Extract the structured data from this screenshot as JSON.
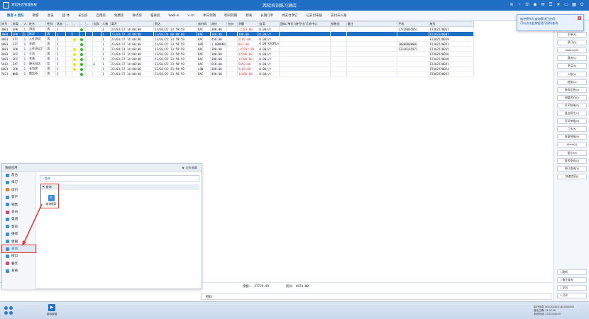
{
  "titlebar": {
    "app_name": "宾馆住店管理系统",
    "window_title": "西软培训练习酒店",
    "icons": [
      "wifi-icon",
      "bell-icon",
      "phone-icon",
      "chat-icon",
      "message-icon",
      "list-icon",
      "star-icon",
      "monitor-icon",
      "grid-icon",
      "power-icon"
    ]
  },
  "tabs": [
    "散客 & 团队",
    "散客",
    "会员",
    "团 体",
    "长包房",
    "自用房",
    "免费房",
    "钟点房",
    "临离房",
    "Walk-in",
    "V I P",
    "本日到期",
    "明日到期",
    "预离",
    "长期订单",
    "待支付预订",
    "已支付未抵",
    "支付未入账"
  ],
  "table": {
    "headers": [
      "房号",
      "房类",
      "人",
      "姓名",
      "性别",
      "状态",
      "-",
      "-",
      "-",
      "-",
      "欠款",
      "人数",
      "离开",
      "到达",
      "房价码",
      "房价",
      "包价",
      "余额",
      "信用",
      "团体/单位/旅行社/订房中心",
      "销售员",
      "备注",
      "手机",
      "账号"
    ],
    "rows": [
      {
        "room": "3001",
        "type": "SPK",
        "n": "1",
        "name": "测试",
        "sex": "男",
        "st": "I",
        "d1": "",
        "d2": "",
        "d3": "green",
        "d4": "",
        "owe": "",
        "num": "1",
        "dep": "23/03/17 14:00:00",
        "arr": "23/03/22 23:59:59",
        "code": "RAC",
        "rate": "388.00",
        "pkg": "",
        "bal": "-2183.00",
        "bal_neg": true,
        "credit": "0.00///",
        "group": "",
        "sales": "",
        "memo": "",
        "phone": "17328065051",
        "acct": "F2302220017",
        "sel": false
      },
      {
        "room": "3004",
        "type": "SPK",
        "n": "1",
        "name": "陈洋",
        "sex": "男",
        "st": "I",
        "d1": "",
        "d2": "",
        "d3": "",
        "d4": "",
        "owe": "",
        "num": "1",
        "dep": "23/03/17 14:00:00",
        "arr": "23/03/24 00:00:00",
        "code": "RAC",
        "rate": "388.00",
        "pkg": "",
        "bal": "388.00",
        "bal_neg": false,
        "credit": "0.00///",
        "group": "",
        "sales": "",
        "memo": "",
        "phone": "",
        "acct": "F2303140001",
        "sel": true
      },
      {
        "room": "4001",
        "type": "STT",
        "n": "1",
        "name": "入住测试",
        "sex": "男",
        "st": "I",
        "d1": "",
        "d2": "yellow",
        "d3": "green",
        "d4": "",
        "owe": "",
        "num": "1",
        "dep": "23/03/17 14:00:00",
        "arr": "23/03/22 23:59:59",
        "code": "RAC",
        "rate": "458.00",
        "pkg": "",
        "bal": "5185.00",
        "bal_neg": true,
        "credit": "0.00///",
        "group": "",
        "sales": "",
        "memo": "",
        "phone": "",
        "acct": "F2302220019",
        "sel": false
      },
      {
        "room": "4003",
        "type": "STT",
        "n": "1",
        "name": "李斌",
        "sex": "男",
        "st": "I",
        "d1": "",
        "d2": "",
        "d3": "green",
        "d4": "",
        "owe": "",
        "num": "1",
        "dep": "23/03/17 14:00:00",
        "arr": "23/03/22 23:59:59",
        "code": "GRP",
        "rate": "1.00DKK0",
        "pkg": "",
        "bal": "861.00",
        "bal_neg": true,
        "credit": "0.00飞利团队///",
        "group": "",
        "sales": "",
        "memo": "",
        "phone": "18800000003",
        "acct": "F2302220023",
        "sel": false
      },
      {
        "room": "3081",
        "type": "SPK",
        "n": "1",
        "name": "入住测试2",
        "sex": "男",
        "st": "I",
        "d1": "",
        "d2": "yellow",
        "d3": "green",
        "d4": "",
        "owe": "",
        "num": "1",
        "dep": "23/04/11 14:00:00",
        "arr": "23/03/22 23:59:59",
        "code": "RAC",
        "rate": "388.00",
        "pkg": "",
        "bal": "-87592.00",
        "bal_neg": true,
        "credit": "0.00///",
        "group": "",
        "sales": "",
        "memo": "",
        "phone": "13336165971",
        "acct": "F2302220015",
        "sel": false
      },
      {
        "room": "3083",
        "type": "SPI",
        "n": "1",
        "name": "王尚",
        "sex": "男",
        "st": "I",
        "d1": "",
        "d2": "yellow",
        "d3": "green",
        "d4": "",
        "owe": "",
        "num": "1",
        "dep": "23/03/17 14:00:00",
        "arr": "23/03/22 23:59:59",
        "code": "RAC",
        "rate": "388.00",
        "pkg": "",
        "bal": "12188.00",
        "bal_neg": true,
        "credit": "0.00///",
        "group": "",
        "sales": "",
        "memo": "",
        "phone": "",
        "acct": "F2302220016",
        "sel": false
      },
      {
        "room": "5083",
        "type": "SPI",
        "n": "1",
        "name": "李逸",
        "sex": "男",
        "st": "I",
        "d1": "",
        "d2": "yellow",
        "d3": "green",
        "d4": "",
        "owe": "",
        "num": "1",
        "dep": "23/03/17 14:00:00",
        "arr": "23/03/22 23:59:59",
        "code": "RAC",
        "rate": "388.00",
        "pkg": "",
        "bal": "12188.00",
        "bal_neg": true,
        "credit": "0.00///",
        "group": "",
        "sales": "",
        "memo": "",
        "phone": "",
        "acct": "F2302220020",
        "sel": false
      },
      {
        "room": "5012",
        "type": "EXT",
        "n": "1",
        "name": "康光回店",
        "sex": "女",
        "st": "I",
        "d1": "",
        "d2": "yellow",
        "d3": "green",
        "d4": "",
        "owe": "6",
        "num": "1",
        "dep": "23/03/17 14:00:00",
        "arr": "23/03/22 23:59:59",
        "code": "RAC",
        "rate": "658.00",
        "pkg": "",
        "bal": "5658.00",
        "bal_neg": true,
        "credit": "0.00///",
        "group": "",
        "sales": "",
        "memo": "",
        "phone": "",
        "acct": "F2302220021",
        "sel": false
      },
      {
        "room": "6001",
        "type": "SPK",
        "n": "1",
        "name": "长包房",
        "sex": "男",
        "st": "I",
        "d1": "",
        "d2": "yellow",
        "d3": "green",
        "d4": "",
        "owe": "",
        "num": "1",
        "dep": "23/03/17 14:00:00",
        "arr": "23/03/22 23:59:59",
        "code": "LON",
        "rate": "388.00",
        "pkg": "",
        "bal": "5169.00",
        "bal_neg": true,
        "credit": "0.00///",
        "group": "",
        "sales": "",
        "memo": "",
        "phone": "",
        "acct": "F2302220024",
        "sel": false
      },
      {
        "room": "7021",
        "type": "NKD",
        "n": "1",
        "name": "散店所",
        "sex": "男",
        "st": "I",
        "d1": "",
        "d2": "",
        "d3": "green",
        "d4": "",
        "owe": "",
        "num": "1",
        "dep": "23/03/17 14:00:00",
        "arr": "23/03/22 23:59:59",
        "code": "RAC",
        "rate": "498.00",
        "pkg": "",
        "bal": "14488.00",
        "bal_neg": true,
        "credit": "0.00///",
        "group": "",
        "sales": "",
        "memo": "",
        "phone": "",
        "acct": "F2302220022",
        "sel": false
      }
    ]
  },
  "summary": {
    "balance": "余额: -17729.99",
    "credit": "房价: 4674.00"
  },
  "notice": {
    "label": "招标"
  },
  "sidebar": {
    "buttons": [
      "主单(F)",
      "预订(R)",
      "Walk-in(W)",
      "换房(C)",
      "电话(A)",
      "入账(V)",
      "结账(O)",
      "修改信息(U)",
      "调整房价(E)",
      "打印账单(P)",
      "退出照片(H)",
      "打印单据(N)",
      "门卡(K)",
      "批量结账(B)",
      "Alerts(L)",
      "留言(M)",
      "客房查询(Q)",
      "预订查询(Y)",
      "快速信息(I)"
    ],
    "bottom": [
      "刷新",
      "备注查询",
      "导出",
      "打印"
    ]
  },
  "tooltip": {
    "line1": "维护接待与查询模块已启用,",
    "line2": "可以点击此按钮进行接待查询",
    "close": "x"
  },
  "panel": {
    "title": "系统应用",
    "fav": "★ 对账收藏",
    "menu": [
      {
        "label": "前台",
        "color": "#3a8fe0",
        "hl": false
      },
      {
        "label": "排订",
        "color": "#3a8fe0",
        "hl": false
      },
      {
        "label": "房价",
        "color": "#e8832c",
        "hl": false
      },
      {
        "label": "客户",
        "color": "#3a8fe0",
        "hl": false
      },
      {
        "label": "销售",
        "color": "#3a8fe0",
        "hl": false
      },
      {
        "label": "会员",
        "color": "#d84a6c",
        "hl": false
      },
      {
        "label": "渠道",
        "color": "#3a8fe0",
        "hl": false
      },
      {
        "label": "客房",
        "color": "#3a8fe0",
        "hl": false
      },
      {
        "label": "维修",
        "color": "#3a8fe0",
        "hl": false
      },
      {
        "label": "收银",
        "color": "#3a8fe0",
        "hl": false
      },
      {
        "label": "查询",
        "color": "#3a8fe0",
        "hl": true
      },
      {
        "label": "接口",
        "color": "#3a8fe0",
        "hl": false
      },
      {
        "label": "餐饮",
        "color": "#d84a6c",
        "hl": false
      },
      {
        "label": "系统",
        "color": "#3a8fe0",
        "hl": false
      }
    ],
    "search_placeholder": "查询",
    "crumb": "查询",
    "func_label": "查询搜索"
  },
  "taskbar": {
    "app_label": "接待收银",
    "info1": "用户信息: 001/2015/02 @10000000",
    "info2": "营业日期: 23-02-15",
    "info3": "系统时间: 17/23 8:44:49"
  }
}
